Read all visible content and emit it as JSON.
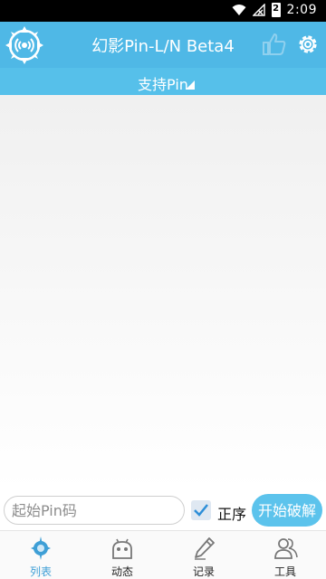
{
  "status_bar": {
    "time": "2:09",
    "battery_level": "2"
  },
  "app_bar": {
    "title": "幻影Pin-L/N Beta4",
    "icons": [
      "radar-logo-icon",
      "thumbs-up-icon",
      "gear-icon"
    ]
  },
  "filter": {
    "label": "支持Pin"
  },
  "action_row": {
    "pin_placeholder": "起始Pin码",
    "order_checked": true,
    "order_label": "正序",
    "start_label": "开始破解"
  },
  "bottom_nav": {
    "items": [
      {
        "label": "列表",
        "icon": "compass-icon",
        "active": true
      },
      {
        "label": "动态",
        "icon": "android-icon",
        "active": false
      },
      {
        "label": "记录",
        "icon": "pencil-icon",
        "active": false
      },
      {
        "label": "工具",
        "icon": "users-icon",
        "active": false
      }
    ]
  },
  "colors": {
    "primary": "#4fb8e6",
    "subbar": "#56c0ea",
    "active_nav": "#3e9fd6"
  }
}
